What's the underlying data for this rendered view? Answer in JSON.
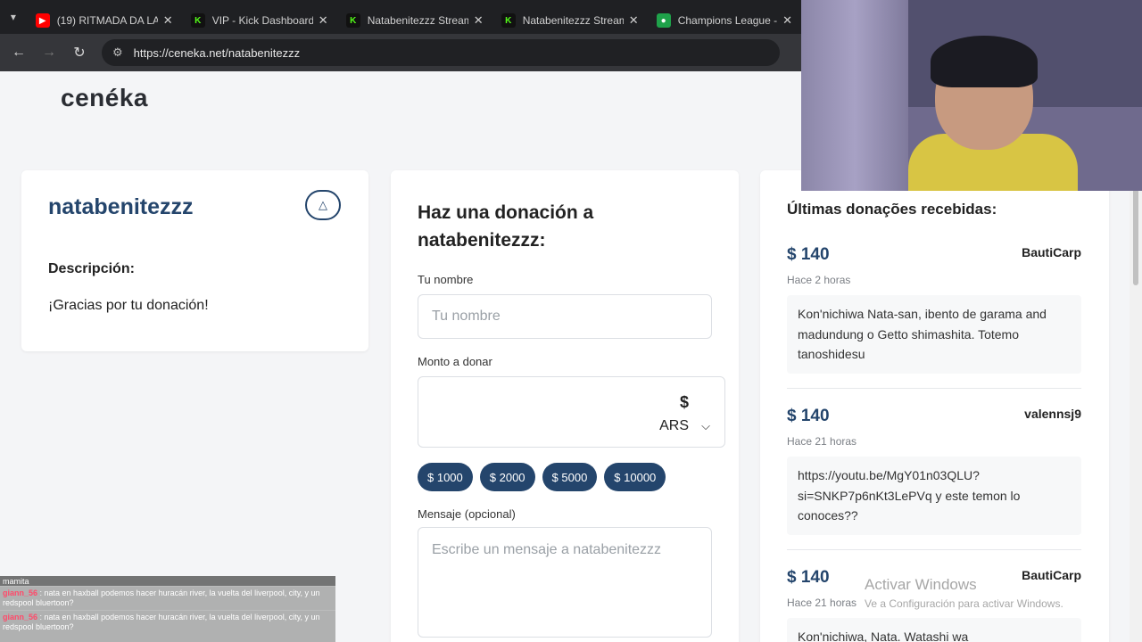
{
  "browser": {
    "tabs": [
      {
        "title": "(19) RITMADA DA LA",
        "icon": "youtube-icon"
      },
      {
        "title": "VIP - Kick Dashboard",
        "icon": "kick-icon"
      },
      {
        "title": "Natabenitezzz Stream",
        "icon": "kick-icon"
      },
      {
        "title": "Natabenitezzz Stream",
        "icon": "kick-icon"
      },
      {
        "title": "Champions League -",
        "icon": "football-icon"
      }
    ],
    "url": "https://ceneka.net/natabenitezzz"
  },
  "site": {
    "logo": "cenéka"
  },
  "profile": {
    "username": "natabenitezzz",
    "description_label": "Descripción:",
    "description": "¡Gracias por tu donación!"
  },
  "donation_form": {
    "title": "Haz una donación a natabenitezzz:",
    "name_label": "Tu nombre",
    "name_placeholder": "Tu nombre",
    "amount_label": "Monto a donar",
    "currency_symbol": "$",
    "currency_code": "ARS",
    "presets": [
      "$ 1000",
      "$ 2000",
      "$ 5000",
      "$ 10000"
    ],
    "message_label": "Mensaje (opcional)",
    "message_placeholder": "Escribe un mensaje a natabenitezzz"
  },
  "recent": {
    "title": "Últimas donações recebidas:",
    "items": [
      {
        "amount": "$ 140",
        "donor": "BautiCarp",
        "time": "Hace 2 horas",
        "message": "Kon'nichiwa Nata-san, ibento de garama and madundung o Getto shimashita. Totemo tanoshidesu"
      },
      {
        "amount": "$ 140",
        "donor": "valennsj9",
        "time": "Hace 21 horas",
        "message": "https://youtu.be/MgY01n03QLU?si=SNKP7p6nKt3LePVq y este temon lo conoces??"
      },
      {
        "amount": "$ 140",
        "donor": "BautiCarp",
        "time": "Hace 21 horas",
        "message": "Kon'nichiwa, Nata. Watashi wa"
      }
    ]
  },
  "chat": {
    "header": "mamita",
    "lines": [
      {
        "user": "giann_56",
        "text": ": nata en haxball podemos hacer huracán river, la vuelta del liverpool, city, y un redspool bluertoon?"
      },
      {
        "user": "giann_56",
        "text": ": nata en haxball podemos hacer huracán river, la vuelta del liverpool, city, y un redspool bluertoon?"
      }
    ]
  },
  "watermark": {
    "title": "Activar Windows",
    "subtitle": "Ve a Configuración para activar Windows."
  },
  "colors": {
    "accent": "#24456c",
    "tabbar": "#1f2023",
    "toolbar": "#35363a"
  }
}
